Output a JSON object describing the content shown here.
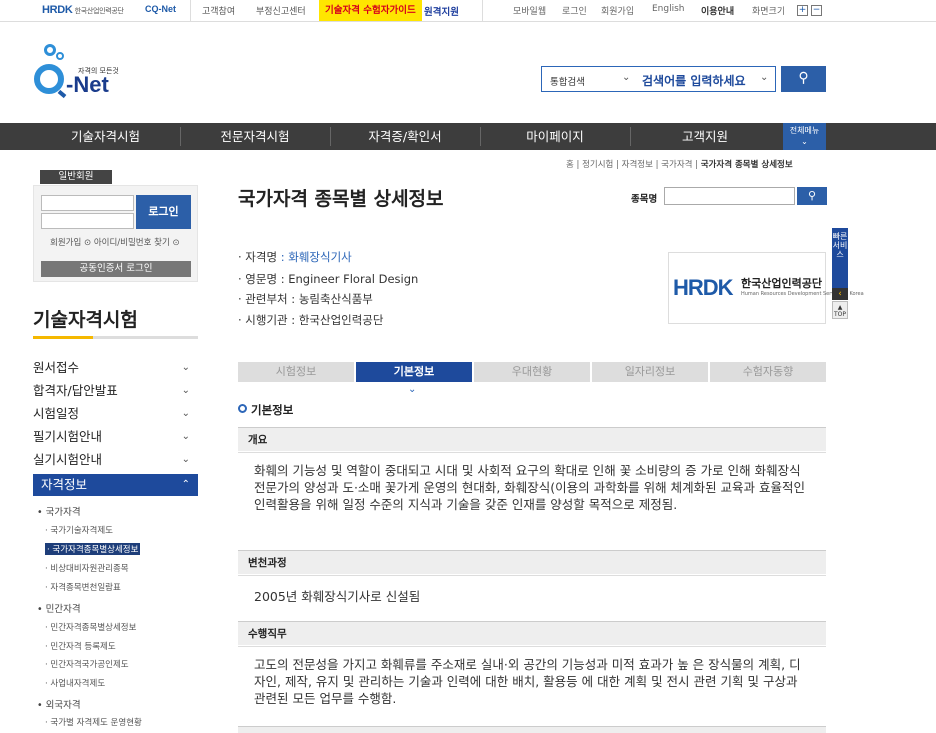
{
  "topbar": {
    "hrdk": "HRDK",
    "hrdk_sub": "한국산업인력공단",
    "cqnet": "CQ-Net",
    "links": [
      "고객참여",
      "부정신고센터"
    ],
    "guide": "기술자격 수험자가이드",
    "remote": "원격지원",
    "right_links": [
      "모바일웹",
      "로그인",
      "회원가입",
      "English",
      "이용안내",
      "화면크기"
    ],
    "plus": "+",
    "minus": "−"
  },
  "logo": {
    "tagline": "자격의 모든것",
    "name": "-Net"
  },
  "search": {
    "scope": "통합검색",
    "placeholder": "검색어를 입력하세요"
  },
  "gnb": {
    "items": [
      "기술자격시험",
      "전문자격시험",
      "자격증/확인서",
      "마이페이지",
      "고객지원"
    ],
    "all_menu": "전체메뉴"
  },
  "breadcrumb": {
    "path": "홈 | 정기시험 | 자격정보 | 국가자격 | ",
    "current": "국가자격 종목별 상세정보"
  },
  "login": {
    "member_label": "일반회원",
    "button": "로그인",
    "signup": "회원가입",
    "find": "아이디/비밀번호 찾기",
    "cert": "공동인증서 로그인"
  },
  "sidebar": {
    "title": "기술자격시험",
    "menu": [
      "원서접수",
      "합격자/답안발표",
      "시험일정",
      "필기시험안내",
      "실기시험안내",
      "자격정보"
    ],
    "sub": {
      "s1": "• 국가자격",
      "s1a": "· 국가기술자격제도",
      "s1b": "· 국가자격종목별상세정보",
      "s1c": "· 비상대비자원관리종목",
      "s1d": "· 자격종목변천일람표",
      "s2": "• 민간자격",
      "s2a": "· 민간자격종목별상세정보",
      "s2b": "· 민간자격 등록제도",
      "s2c": "· 민간자격국가공인제도",
      "s2d": "· 사업내자격제도",
      "s3": "• 외국자격",
      "s3a": "· 국가별 자격제도 운영현황"
    }
  },
  "main": {
    "title": "국가자격 종목별 상세정보",
    "jongmok_label": "종목명",
    "info": [
      {
        "label": "· 자격명",
        "value": ": 화훼장식기사"
      },
      {
        "label": "· 영문명",
        "value": ": Engineer Floral Design"
      },
      {
        "label": "· 관련부처",
        "value": ": 농림축산식품부"
      },
      {
        "label": "· 시행기관",
        "value": ": 한국산업인력공단"
      }
    ],
    "agency_logo": {
      "mark": "HRDK",
      "name": "한국산업인력공단",
      "english": "Human Resources Development Service of Korea"
    },
    "tabs": [
      "시험정보",
      "기본정보",
      "우대현황",
      "일자리정보",
      "수험자동향"
    ],
    "section_title": "기본정보",
    "blocks": [
      {
        "head": "개요",
        "body": "화훼의 기능성 및 역할이 중대되고 시대 및 사회적 요구의 확대로 인해 꽃 소비량의 증 가로 인해 화훼장식 전문가의 양성과 도·소매 꽃가게 운영의 현대화, 화훼장식(이용의 과학화를 위해 체계화된 교육과 효율적인 인력활용을 위해 일정 수준의 지식과 기술을 갖준 인재를 양성할 목적으로 제정됨."
      },
      {
        "head": "변천과정",
        "body": "2005년 화훼장식기사로 신설됨"
      },
      {
        "head": "수행직무",
        "body": "고도의 전문성을 가지고 화훼류를 주소재로 실내·외 공간의 기능성과 미적 효과가 높 은 장식물의 계획, 디자인, 제작, 유지 및 관리하는 기술과 인력에 대한 배치, 활용등 에 대한 계획 및 전시 관련 기획 및 구상과 관련된 모든 업무를 수행함."
      }
    ]
  },
  "quick": {
    "label": "빠른서비스",
    "top": "TOP"
  }
}
